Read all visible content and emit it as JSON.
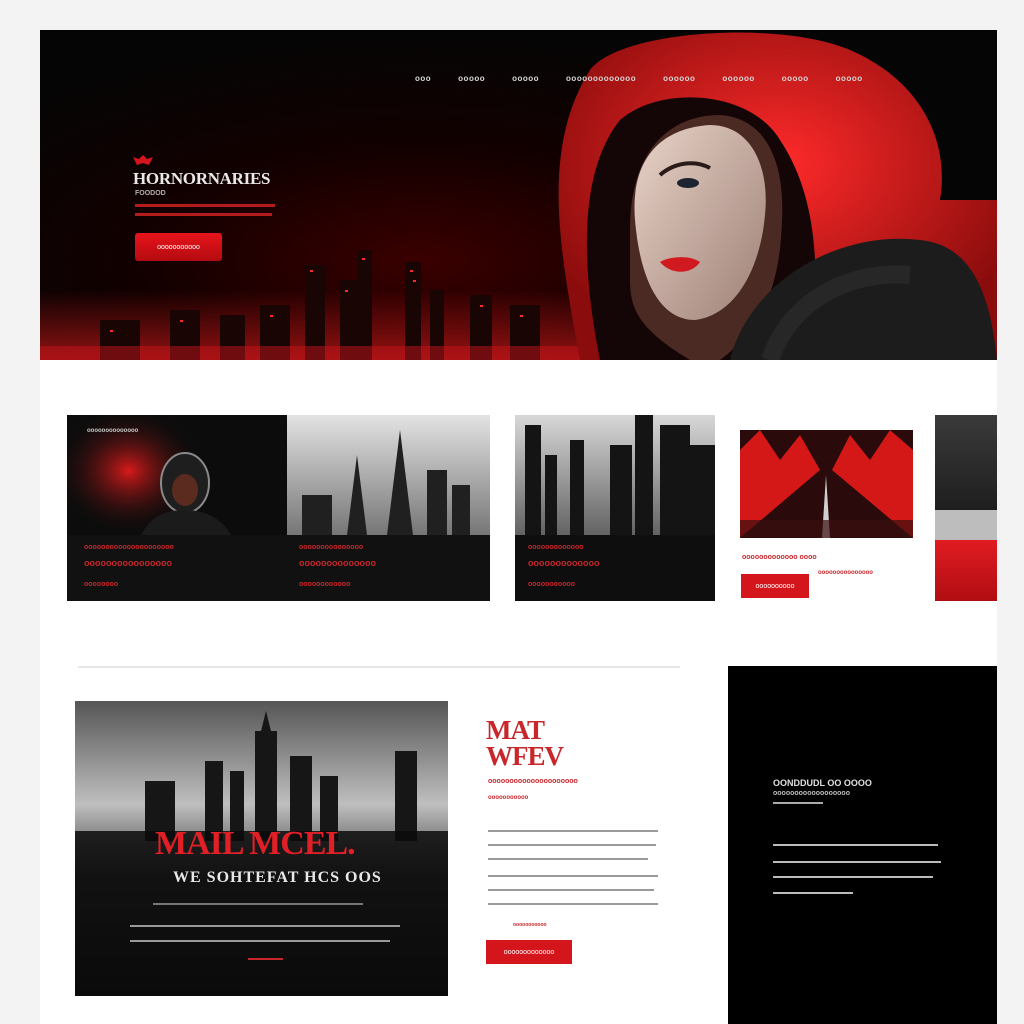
{
  "colors": {
    "accent": "#d4151c",
    "dark": "#050505",
    "panel": "#000000",
    "background": "#ffffff"
  },
  "nav": {
    "items": [
      "ooo",
      "ooooo",
      "ooooo",
      "ooooooooooooo",
      "oooooo",
      "oooooo",
      "ooooo",
      "ooooo"
    ]
  },
  "hero": {
    "brand_title": "HORNORNARIES",
    "brand_sub": "FOODOD",
    "cta_label": "ooooooooooo"
  },
  "cards": {
    "card1": {
      "label": "oooooooooooooo",
      "line1": "ooooooooooooooooooooo",
      "line2": "oooooooooooooooo",
      "line3": "oooooooo"
    },
    "card2": {
      "line1": "ooooooooooooooo",
      "line2": "oooooooooooooo",
      "line3": "oooooooooooo"
    },
    "card3": {
      "line1": "ooooooooooooo",
      "line2": "ooooooooooooo",
      "line3": "ooooooooooo"
    },
    "card4": {
      "caption": "ooooooooooooo oooo",
      "button_label": "oooooooooo",
      "sub": "ooooooooooooooo"
    }
  },
  "poster": {
    "title": "MAIL MCEL.",
    "subtitle": "WE SOHTEFAT HCS OOS"
  },
  "article": {
    "heading_line1": "MAT",
    "heading_line2": "WFEV",
    "subheading": "ooooooooooooooooooooo",
    "tagline": "ooooooooooo",
    "link": "ooooooooooo",
    "button_label": "ooooooooooooo"
  },
  "side_panel": {
    "title": "OONDDUDL OO OOOO",
    "subtitle": "oooooooooooooooooo"
  }
}
